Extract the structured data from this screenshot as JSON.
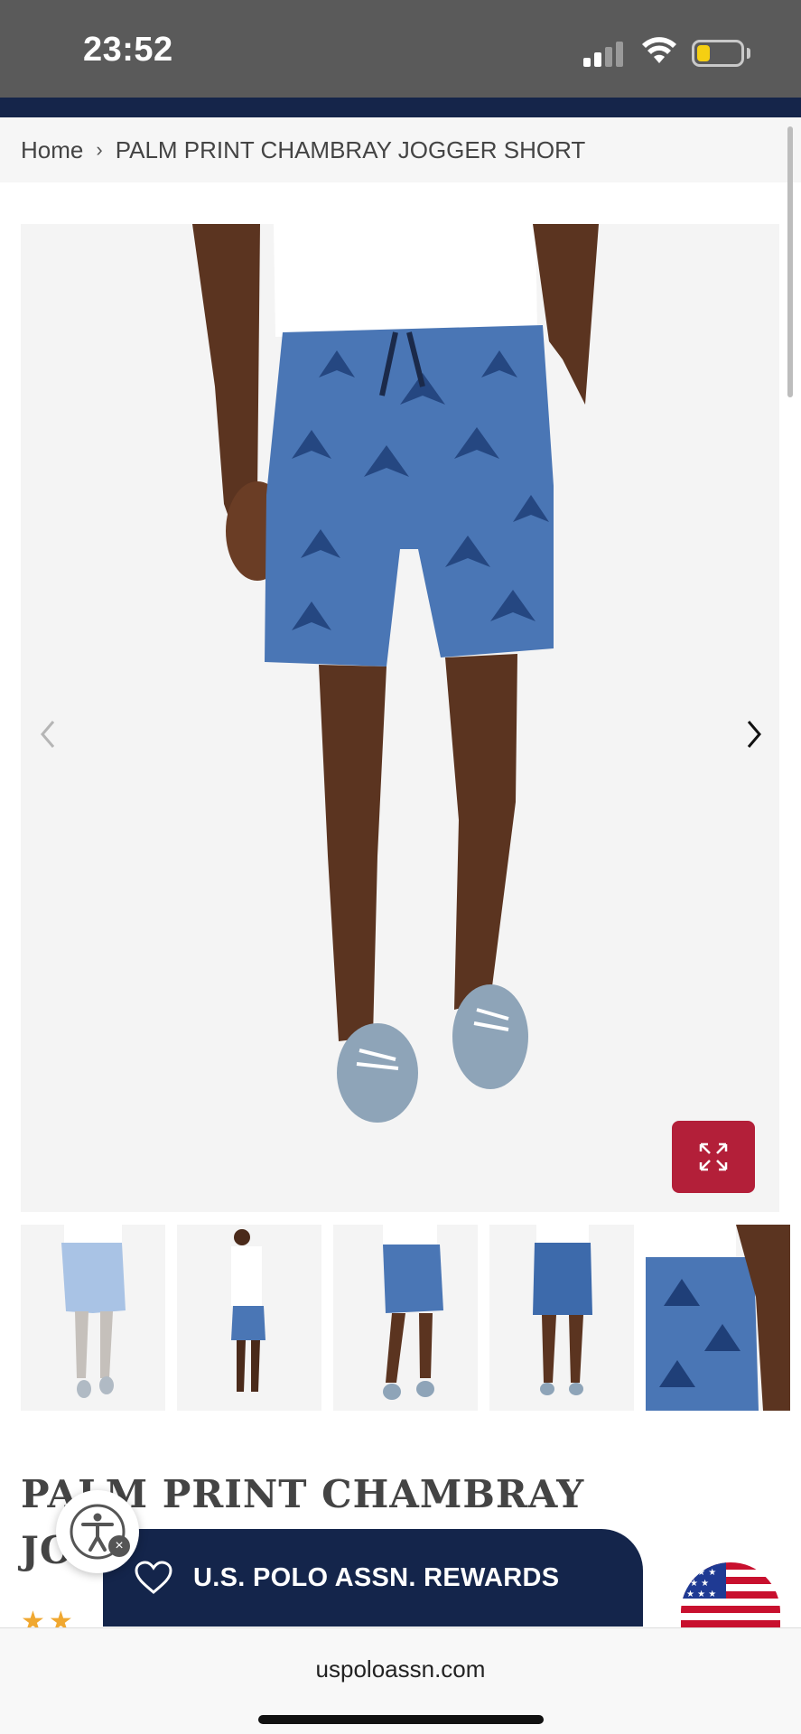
{
  "status_bar": {
    "time": "23:52",
    "icons": [
      "signal-icon",
      "wifi-icon",
      "battery-icon"
    ],
    "battery_color": "#f5cf12"
  },
  "breadcrumb": {
    "home": "Home",
    "separator": "›",
    "current": "PALM PRINT CHAMBRAY JOGGER SHORT"
  },
  "gallery": {
    "prev_icon": "chevron-left-icon",
    "next_icon": "chevron-right-icon",
    "expand_icon": "expand-icon",
    "thumbnails_count": 5
  },
  "product": {
    "title": "PALM PRINT CHAMBRAY JOGGER SHORT"
  },
  "rewards": {
    "label": "U.S. POLO ASSN. REWARDS",
    "icon": "heart-icon"
  },
  "rating": {
    "stars": "★★"
  },
  "browser": {
    "url": "uspoloassn.com"
  },
  "colors": {
    "navy": "#14254b",
    "accent_red": "#b31f39",
    "star": "#f0a831"
  }
}
